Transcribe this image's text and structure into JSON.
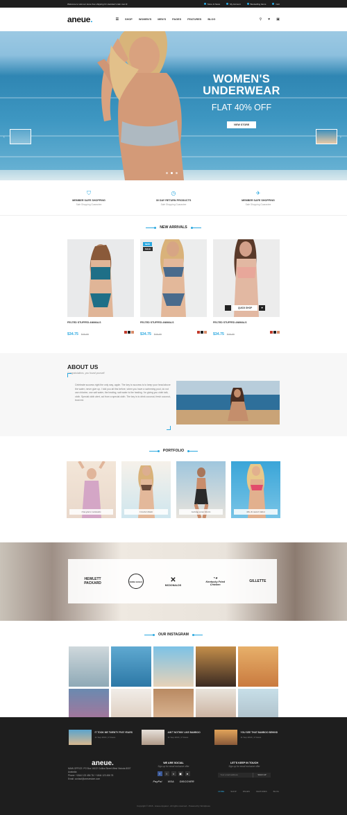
{
  "topbar": {
    "welcome": "Welcome to visit our store",
    "promo": "free shipping for standard order over $",
    "links": [
      "Store & News",
      "My Account",
      "Bestselling Items",
      "Cart"
    ]
  },
  "nav": {
    "logo_main": "aneue",
    "logo_dot": ".",
    "menu": [
      "SHOP",
      "WOMEN'S",
      "MEN'S",
      "PAGES",
      "FEATURES",
      "BLOG"
    ]
  },
  "hero": {
    "title_line1": "WOMEN'S",
    "title_line2": "UNDERWEAR",
    "subtitle": "FLAT 40% OFF",
    "button": "VIEW STORE"
  },
  "features": [
    {
      "icon": "shield-icon",
      "title": "MEMBER SAFE SHOPPING",
      "sub": "Safe Shopping Guarantee"
    },
    {
      "icon": "clock-icon",
      "title": "30 DAY RETURN PRODUCTS",
      "sub": "Safe Shopping Guarantee"
    },
    {
      "icon": "plane-icon",
      "title": "MEMBER SAFE SHOPPING",
      "sub": "Safe Shopping Guarantee"
    }
  ],
  "new_arrivals": {
    "title": "NEW ARRIVALS",
    "products": [
      {
        "name": "FELTED STUFFED ANIMALS",
        "price": "$34.75",
        "old": "$39.95",
        "badges": []
      },
      {
        "name": "FELTED STUFFED ANIMALS",
        "price": "$34.75",
        "old": "$39.95",
        "badges": [
          "NEW",
          "SALE"
        ]
      },
      {
        "name": "FELTED STUFFED ANIMALS",
        "price": "$34.75",
        "old": "$39.95",
        "badges": [],
        "quick": "QUICK SHOP"
      }
    ],
    "swatches": [
      "#c0392b",
      "#222222",
      "#d98c6a"
    ]
  },
  "about": {
    "title": "ABOUT US",
    "subtitle": "Congratulations, you found yourself.",
    "body": "Celebrate success right the only way, apple. The key to success is to keep your head above the water, never give up. I told you all this before, when you have a swimming pool, do not use chlorine, use salt water, the healing, salt water is the healing. I'm giving you cloth talk, cloth. Special cloth alert, cut from a special cloth. The key is to drink coconut, fresh coconut, trust me."
  },
  "portfolio": {
    "title": "PORTFOLIO",
    "items": [
      "One-piece swimsuits",
      "Crochet bikini",
      "Jacking some Shorts",
      "Mix & match bikini"
    ]
  },
  "brands": [
    "HEWLETT PACKARD",
    "SODA GOLD",
    "MCDONALDS",
    "Kentucky Fried Chicken",
    "GILLETTE"
  ],
  "instagram": {
    "title": "OUR INSTAGRAM"
  },
  "footer": {
    "posts": [
      {
        "title": "IT TOOK ME TWENTY FIVE YEARS",
        "meta": "11 Sep 2016 | 3 Views"
      },
      {
        "title": "AIN'T NOTHIN' LIKE BAMBOO",
        "meta": "11 Sep 2016 | 3 Views"
      },
      {
        "title": "YOU SEE THAT BAMBOO BEHIND",
        "meta": "11 Sep 2016 | 3 Views"
      }
    ],
    "logo": "aneue.",
    "address": "MAIN OFFICE: PO Box 16122 Collins Street West Victoria 8007 Australia",
    "phone": "Phone: +1844 123 456 78 / +1844 123 456 78",
    "email": "Email: contact@aneuestore.com",
    "social_title": "WE ARE SOCIAL",
    "social_sub": "Sign up for email exclusive offer",
    "social_icons": [
      "f",
      "t",
      "v",
      "▣",
      "●"
    ],
    "payments": [
      "PayPal",
      "VISA",
      "DISCOVER"
    ],
    "news_title": "LET'S KEEP IN TOUCH",
    "news_sub": "Sign up for email exclusive offer",
    "news_placeholder": "Your email address",
    "news_button": "SIGN UP",
    "menu": [
      "HOME",
      "SHOP",
      "PAGES",
      "FEATURES",
      "BLOG"
    ],
    "copyright": "Copyright © 2016 - Aneue Apparel - All rights reserved - Powered by Wordpress"
  }
}
